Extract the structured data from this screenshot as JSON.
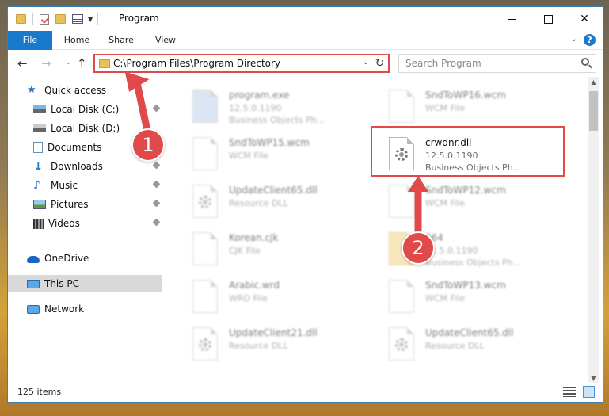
{
  "window": {
    "title": "Program",
    "close_glyph": "✕"
  },
  "ribbon": {
    "tabs": [
      "File",
      "Home",
      "Share",
      "View"
    ],
    "help": "?"
  },
  "navigation": {
    "address": "C:\\Program Files\\Program Directory",
    "search_placeholder": "Search Program"
  },
  "sidebar": {
    "items": [
      {
        "label": "Quick access",
        "icon": "star-icon"
      },
      {
        "label": "Local Disk (C:)",
        "icon": "drive-icon",
        "pinned": true
      },
      {
        "label": "Local Disk (D:)",
        "icon": "drive-icon"
      },
      {
        "label": "Documents",
        "icon": "documents-icon",
        "pinned": true
      },
      {
        "label": "Downloads",
        "icon": "download-icon",
        "pinned": true
      },
      {
        "label": "Music",
        "icon": "music-icon",
        "pinned": true
      },
      {
        "label": "Pictures",
        "icon": "pictures-icon",
        "pinned": true
      },
      {
        "label": "Videos",
        "icon": "videos-icon",
        "pinned": true
      },
      {
        "label": "OneDrive",
        "icon": "cloud-icon"
      },
      {
        "label": "This PC",
        "icon": "computer-icon",
        "selected": true
      },
      {
        "label": "Network",
        "icon": "network-icon"
      }
    ]
  },
  "files": [
    {
      "name": "program.exe",
      "line1": "12.5.0.1190",
      "line2": "Business Objects Ph...",
      "icon": "exe-icon"
    },
    {
      "name": "SndToWP16.wcm",
      "line1": "WCM File",
      "line2": "",
      "icon": "file-icon"
    },
    {
      "name": "SndToWP15.wcm",
      "line1": "WCM File",
      "line2": "",
      "icon": "file-icon"
    },
    {
      "name": "crwdnr.dll",
      "line1": "12.5.0.1190",
      "line2": "Business Objects Ph...",
      "icon": "dll-icon"
    },
    {
      "name": "UpdateClient65.dll",
      "line1": "Resource DLL",
      "line2": "",
      "icon": "dll-icon"
    },
    {
      "name": "SndToWP12.wcm",
      "line1": "WCM File",
      "line2": "",
      "icon": "file-icon"
    },
    {
      "name": "Korean.cjk",
      "line1": "CJK File",
      "line2": "",
      "icon": "file-icon"
    },
    {
      "name": "264",
      "line1": "12.5.0.1190",
      "line2": "Business Objects Ph...",
      "icon": "folder-icon"
    },
    {
      "name": "Arabic.wrd",
      "line1": "WRD File",
      "line2": "",
      "icon": "file-icon"
    },
    {
      "name": "SndToWP13.wcm",
      "line1": "WCM File",
      "line2": "",
      "icon": "file-icon"
    },
    {
      "name": "UpdateClient21.dll",
      "line1": "Resource DLL",
      "line2": "",
      "icon": "dll-icon"
    },
    {
      "name": "UpdateClient65.dll",
      "line1": "Resource DLL",
      "line2": "",
      "icon": "dll-icon"
    }
  ],
  "status": {
    "item_count": "125 items"
  },
  "callouts": [
    "1",
    "2"
  ],
  "colors": {
    "accent": "#1979ca",
    "highlight": "#e04a4a"
  }
}
